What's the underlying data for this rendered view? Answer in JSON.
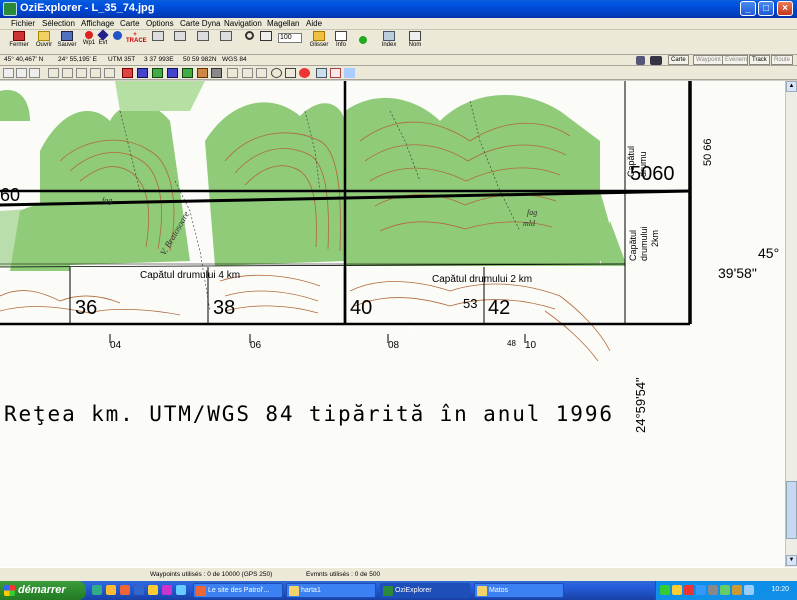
{
  "window": {
    "title": "OziExplorer - L_35_74.jpg",
    "buttons": {
      "minimize": "_",
      "maximize": "□",
      "close": "×"
    }
  },
  "menu": [
    "Fichier",
    "Sélection",
    "Affichage",
    "Carte",
    "Options",
    "Carte Dyna",
    "Navigation",
    "Magellan",
    "Aide"
  ],
  "toolbar": {
    "fermer": "Fermer",
    "ouvrir": "Ouvrir",
    "sauver": "Sauver",
    "wp1": "Wp1",
    "evt": "Evt",
    "trace_label": "+ TRACE",
    "zoom_value": "100",
    "glisser": "Glisser",
    "info": "Info",
    "index": "Index",
    "nom": "Nom"
  },
  "infobar": {
    "lat": "45° 40,467' N",
    "lon": "24° 55,195' E",
    "utm_label": "UTM",
    "utm_zone": "35T",
    "easting": "3 37 993E",
    "northing": "50 59 982N",
    "datum": "WGS 84",
    "tabs": [
      "Carte",
      "Waypoint",
      "Evénements",
      "Track",
      "Route"
    ]
  },
  "map": {
    "grid_labels": [
      "36",
      "38",
      "40",
      "42",
      "5060",
      "50",
      "66",
      "53"
    ],
    "label_60_left": "60",
    "cap_drum_4": "Capătul drumului 4 km",
    "cap_drum_2": "Capătul drumului 2 km",
    "cap_drum_vert": [
      "Capătul",
      "drumului",
      "2km"
    ],
    "cap_drum_top": [
      "Capătul",
      "drumu"
    ],
    "lat_deg": "45°",
    "lat_min": "39'58\"",
    "bottom_ticks": [
      "04",
      "06",
      "08",
      "48",
      "10"
    ],
    "footer_text": "Reţea km. UTM/WGS 84 tipărită în anul 1996",
    "lon_vertical": "24°59'54\"",
    "place_fag": "fag",
    "place_fag2": "fag",
    "place_mld": "mld",
    "stream": "V. Bratosoare",
    "colors": {
      "forest": "#8cc874",
      "contour": "#b06a3a",
      "grid": "#000000"
    }
  },
  "status": {
    "waypoints": "Waypoints utilisés : 0 de 10000  (GPS 250)",
    "events": "Evmnts utilisés : 0 de 500"
  },
  "taskbar": {
    "start": "démarrer",
    "tasks": [
      "Le site des Patrol'...",
      "harta1",
      "OziExplorer",
      "Matos"
    ],
    "clock": "10:20"
  }
}
